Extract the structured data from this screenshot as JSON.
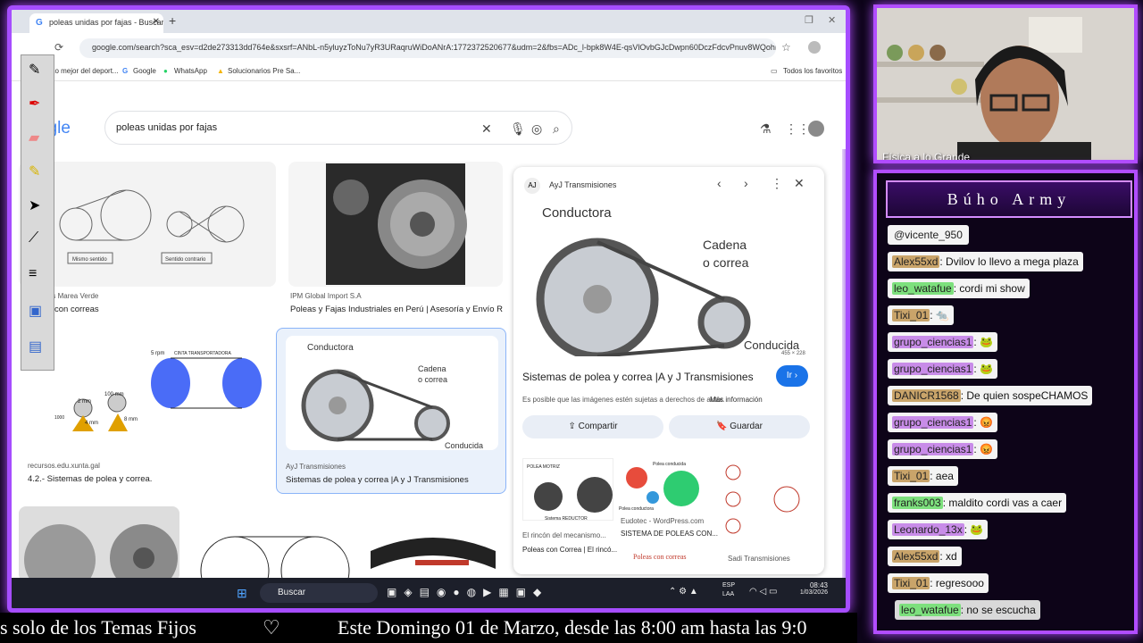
{
  "browser": {
    "tab_title": "poleas unidas por fajas - Buscar",
    "url": "google.com/search?sca_esv=d2de273313dd764e&sxsrf=ANbL-n5yluyzToNu7yR3URaqruWiDoANrA:1772372520677&udm=2&fbs=ADc_l-bpk8W4E-qsVlOvbGJcDwpn60DczFdcvPnuv8WQohHLTaMb_W...",
    "bookmarks": [
      "Lo mejor del deport...",
      "Google",
      "WhatsApp",
      "Solucionarios Pre Sa..."
    ],
    "all_bookmarks": "Todos los favoritos"
  },
  "google": {
    "logo": "ogle",
    "query": "poleas unidas por fajas"
  },
  "results": [
    {
      "source": "Apuntes Marea Verde",
      "title": "con correas",
      "labels": [
        "Mismo sentido",
        "Sentido contrario"
      ]
    },
    {
      "source": "IPM Global Import S.A",
      "title": "Poleas y Fajas Industriales en Perú | Asesoría y Envío R..."
    },
    {
      "source": "recursos.edu.xunta.gal",
      "title": "4.2.- Sistemas de polea y correa.",
      "labels": [
        "5 rpm",
        "CINTA TRANSPORTADORA",
        "100 mm",
        "2 mm",
        "1000",
        "4 mm",
        "8 mm"
      ]
    },
    {
      "source": "AyJ Transmisiones",
      "title": "Sistemas de polea y correa |A y J Transmisiones",
      "labels": [
        "Conductora",
        "Cadena",
        "o correa",
        "Conducida"
      ]
    }
  ],
  "panel": {
    "site": "AyJ Transmisiones",
    "labels": [
      "Conductora",
      "Cadena",
      "o correa",
      "Conducida"
    ],
    "size": "455 × 228",
    "title": "Sistemas de polea y correa |A y J Transmisiones",
    "go": "Ir ›",
    "notice": "Es posible que las imágenes estén sujetas a derechos de autor.",
    "more": "Más información",
    "share": "Compartir",
    "save": "Guardar",
    "related": [
      {
        "img_labels": [
          "POLEA MOTRIZ",
          "Sistema REDUCTOR"
        ],
        "source": "El rincón del mecanismo...",
        "title": "Poleas con Correa | El rincó..."
      },
      {
        "img_labels": [
          "Polea conducida",
          "Polea conductora"
        ],
        "source": "Eudotec - WordPress.com",
        "title": "SISTEMA DE POLEAS CON..."
      },
      {
        "img_labels": [
          "Poleas con correas"
        ],
        "source": "Sadi Transmisiones",
        "title": ""
      }
    ]
  },
  "taskbar": {
    "search": "Buscar",
    "lang": "ESP\nLAA",
    "time": "08:43",
    "date": "1/03/2026"
  },
  "cam": {
    "caption": "Física a lo Grande"
  },
  "chat": {
    "title": "Búho Army",
    "messages": [
      {
        "user": "@vicente_950",
        "text": "",
        "color": "#f4f4f4"
      },
      {
        "user": "Alex55xd",
        "text": ": Dvilov lo llevo a mega plaza",
        "color": "#c9a46a"
      },
      {
        "user": "leo_watafue",
        "text": ": cordi mi show",
        "color": "#7de07d"
      },
      {
        "user": "Tixi_01",
        "text": ": 🐀",
        "color": "#c9a46a"
      },
      {
        "user": "grupo_ciencias1",
        "text": ": 🐸",
        "color": "#c88ce8"
      },
      {
        "user": "grupo_ciencias1",
        "text": ": 🐸",
        "color": "#c88ce8"
      },
      {
        "user": "DANICR1568",
        "text": ": De quien sospeCHAMOS",
        "color": "#c9a46a"
      },
      {
        "user": "grupo_ciencias1",
        "text": ": 😡",
        "color": "#c88ce8"
      },
      {
        "user": "grupo_ciencias1",
        "text": ": 😡",
        "color": "#c88ce8"
      },
      {
        "user": "Tixi_01",
        "text": ": aea",
        "color": "#c9a46a"
      },
      {
        "user": "franks003",
        "text": ": maldito cordi vas a caer",
        "color": "#7de07d"
      },
      {
        "user": "Leonardo_13x",
        "text": ": 🐸",
        "color": "#c88ce8"
      },
      {
        "user": "Alex55xd",
        "text": ": xd",
        "color": "#c9a46a"
      },
      {
        "user": "Tixi_01",
        "text": ": regresooo",
        "color": "#c9a46a"
      },
      {
        "user": "leo_watafue",
        "text": ": no se escucha",
        "color": "#7de07d"
      }
    ]
  },
  "ticker": {
    "part1": "s solo de los Temas Fijos",
    "heart": "♡",
    "part2": "Este Domingo 01 de Marzo, desde las 8:00 am hasta las 9:0"
  }
}
